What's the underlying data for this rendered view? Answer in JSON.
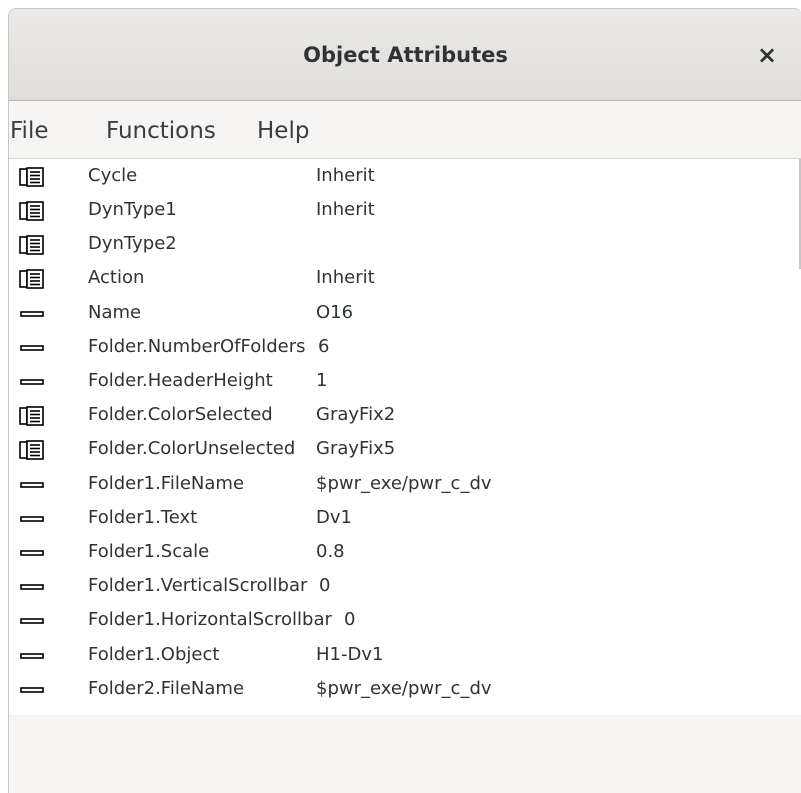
{
  "window": {
    "title": "Object Attributes",
    "close_label": "×"
  },
  "menubar": [
    "File",
    "Functions",
    "Help"
  ],
  "attributes": [
    {
      "icon": "folder",
      "name": "Cycle",
      "value": "Inherit"
    },
    {
      "icon": "folder",
      "name": "DynType1",
      "value": "Inherit"
    },
    {
      "icon": "folder",
      "name": "DynType2",
      "value": ""
    },
    {
      "icon": "folder",
      "name": "Action",
      "value": "Inherit"
    },
    {
      "icon": "dash",
      "name": "Name",
      "value": "O16"
    },
    {
      "icon": "dash",
      "name": "Folder.NumberOfFolders",
      "value": "6"
    },
    {
      "icon": "dash",
      "name": "Folder.HeaderHeight",
      "value": "1"
    },
    {
      "icon": "folder",
      "name": "Folder.ColorSelected",
      "value": "GrayFix2"
    },
    {
      "icon": "folder",
      "name": "Folder.ColorUnselected",
      "value": "GrayFix5"
    },
    {
      "icon": "dash",
      "name": "Folder1.FileName",
      "value": "$pwr_exe/pwr_c_dv"
    },
    {
      "icon": "dash",
      "name": "Folder1.Text",
      "value": "Dv1"
    },
    {
      "icon": "dash",
      "name": "Folder1.Scale",
      "value": "0.8"
    },
    {
      "icon": "dash",
      "name": "Folder1.VerticalScrollbar",
      "value": "0"
    },
    {
      "icon": "dash",
      "name": "Folder1.HorizontalScrollbar",
      "value": "0"
    },
    {
      "icon": "dash",
      "name": "Folder1.Object",
      "value": "H1-Dv1"
    },
    {
      "icon": "dash",
      "name": "Folder2.FileName",
      "value": "$pwr_exe/pwr_c_dv"
    }
  ]
}
